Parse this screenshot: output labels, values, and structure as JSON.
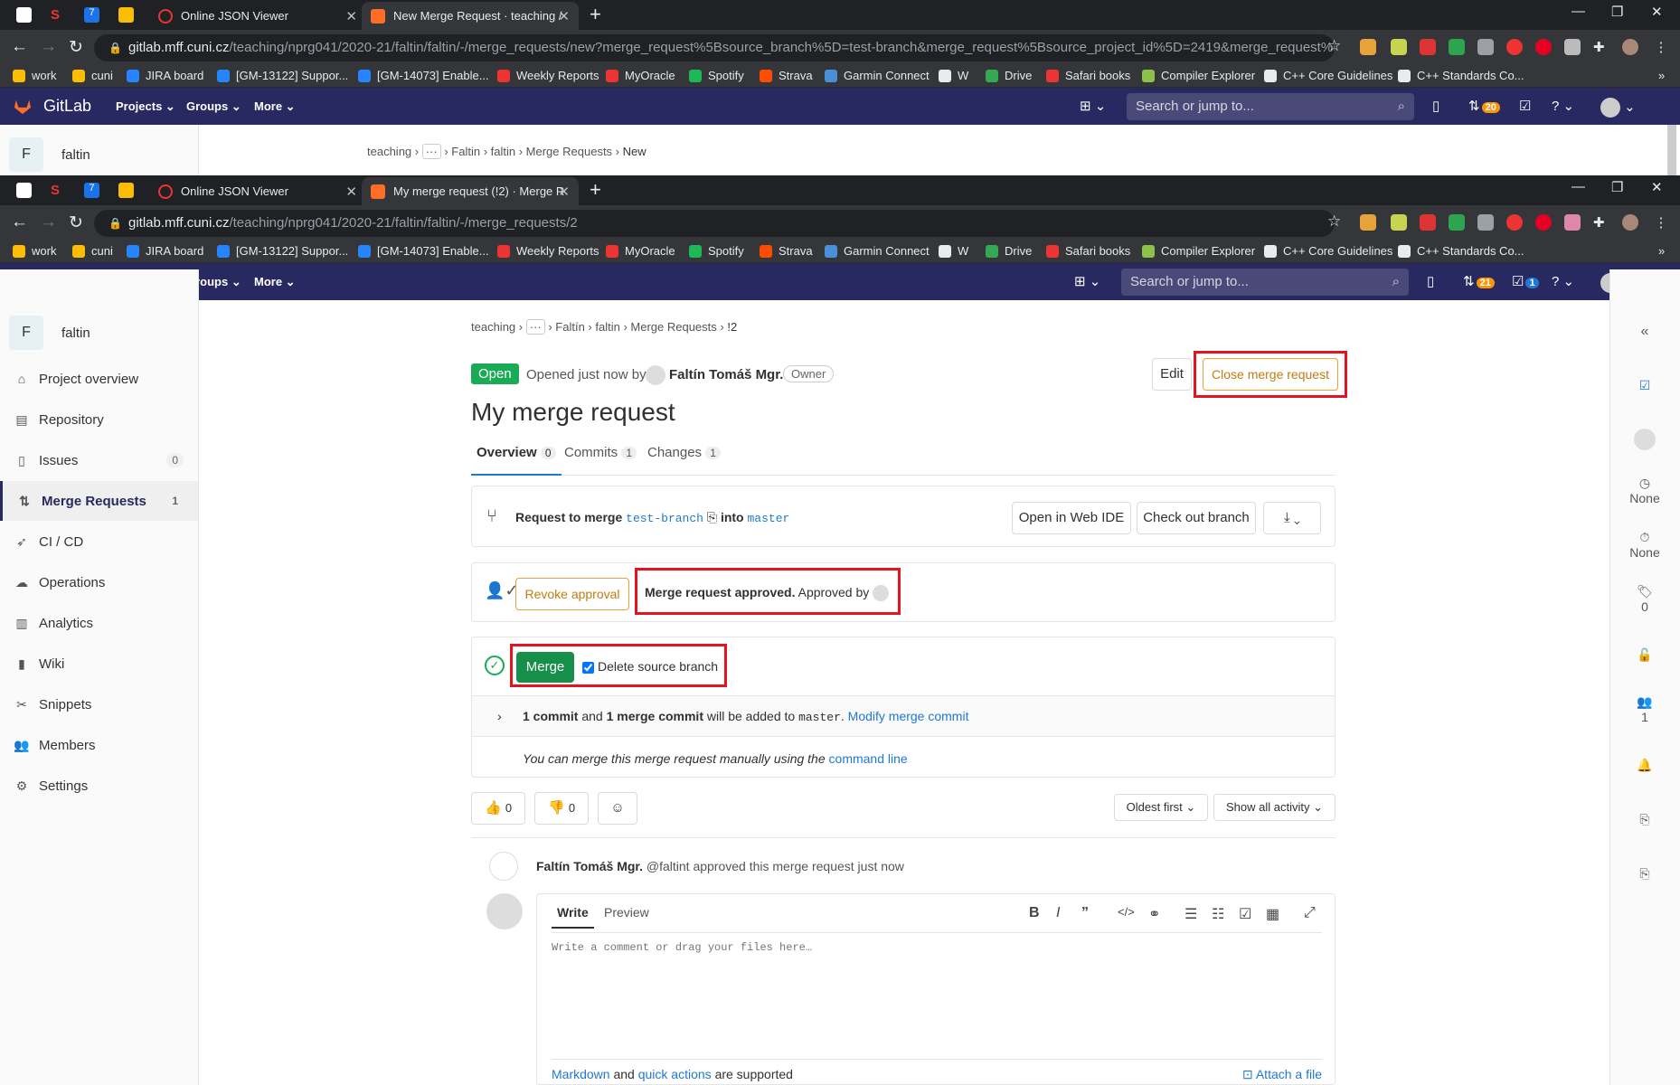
{
  "browser1": {
    "tabs": [
      {
        "label": "Online JSON Viewer"
      },
      {
        "label": "New Merge Request · teaching /"
      }
    ],
    "url_domain": "gitlab.mff.cuni.cz",
    "url_path": "/teaching/nprg041/2020-21/faltin/faltin/-/merge_requests/new?merge_request%5Bsource_branch%5D=test-branch&merge_request%5Bsource_project_id%5D=2419&merge_request%5Btarget_..."
  },
  "browser2": {
    "tabs": [
      {
        "label": "Online JSON Viewer"
      },
      {
        "label": "My merge request (!2) · Merge R"
      }
    ],
    "url_domain": "gitlab.mff.cuni.cz",
    "url_path": "/teaching/nprg041/2020-21/faltin/faltin/-/merge_requests/2"
  },
  "bookmarks": [
    "work",
    "cuni",
    "JIRA board",
    "[GM-13122] Suppor...",
    "[GM-14073] Enable...",
    "Weekly Reports",
    "MyOracle",
    "Spotify",
    "Strava",
    "Garmin Connect",
    "W",
    "Drive",
    "Safari books",
    "Compiler Explorer",
    "C++ Core Guidelines",
    "C++ Standards Co..."
  ],
  "gitlab": {
    "brand": "GitLab",
    "menu": [
      "Projects",
      "Groups",
      "More"
    ],
    "search_placeholder": "Search or jump to...",
    "mr_count_1": "20",
    "mr_count_2": "21",
    "todo_count": "1"
  },
  "project": {
    "initial": "F",
    "name": "faltin"
  },
  "breadcrumb1": [
    "teaching",
    "Faltin",
    "faltin",
    "Merge Requests",
    "New"
  ],
  "breadcrumb2": [
    "teaching",
    "Faltín",
    "faltin",
    "Merge Requests",
    "!2"
  ],
  "sidebar": [
    {
      "label": "Project overview",
      "icon": "home-icon"
    },
    {
      "label": "Repository",
      "icon": "doc-icon"
    },
    {
      "label": "Issues",
      "icon": "issues-icon",
      "count": "0"
    },
    {
      "label": "Merge Requests",
      "icon": "merge-icon",
      "count": "1"
    },
    {
      "label": "CI / CD",
      "icon": "rocket-icon"
    },
    {
      "label": "Operations",
      "icon": "cloud-icon"
    },
    {
      "label": "Analytics",
      "icon": "chart-icon"
    },
    {
      "label": "Wiki",
      "icon": "book-icon"
    },
    {
      "label": "Snippets",
      "icon": "scissors-icon"
    },
    {
      "label": "Members",
      "icon": "users-icon"
    },
    {
      "label": "Settings",
      "icon": "gear-icon"
    }
  ],
  "mr": {
    "status": "Open",
    "opened": "Opened just now by",
    "author": "Faltín Tomáš Mgr.",
    "role": "Owner",
    "edit": "Edit",
    "close": "Close merge request",
    "title": "My merge request",
    "tabs": [
      {
        "label": "Overview",
        "count": "0"
      },
      {
        "label": "Commits",
        "count": "1"
      },
      {
        "label": "Changes",
        "count": "1"
      }
    ],
    "request_to_merge": "Request to merge",
    "source_branch": "test-branch",
    "into": "into",
    "target_branch": "master",
    "open_web_ide": "Open in Web IDE",
    "checkout": "Check out branch",
    "revoke": "Revoke approval",
    "approved_bold": "Merge request approved.",
    "approved_by": "Approved by",
    "merge": "Merge",
    "delete_source": "Delete source branch",
    "commit_info_1": "1 commit",
    "commit_info_and": "and",
    "commit_info_2": "1 merge commit",
    "commit_info_tail": "will be added to",
    "commit_target": "master",
    "modify": "Modify merge commit",
    "manual": "You can merge this merge request manually using the",
    "command_line": "command line",
    "thumbs_up": "0",
    "thumbs_down": "0",
    "sort": "Oldest first",
    "filter": "Show all activity",
    "activity_author": "Faltín Tomáš Mgr.",
    "activity_text": "@faltint approved this merge request just now",
    "write": "Write",
    "preview": "Preview",
    "comment_placeholder": "Write a comment or drag your files here…",
    "markdown": "Markdown",
    "and": "and",
    "quick_actions": "quick actions",
    "supported": "are supported",
    "attach": "Attach a file"
  },
  "right_sidebar": {
    "none1": "None",
    "none2": "None",
    "labels": "0",
    "participants": "1"
  },
  "colors": {
    "accent": "#292961",
    "green": "#1aaa55",
    "red": "#e3141e",
    "link": "#1f78d1"
  }
}
